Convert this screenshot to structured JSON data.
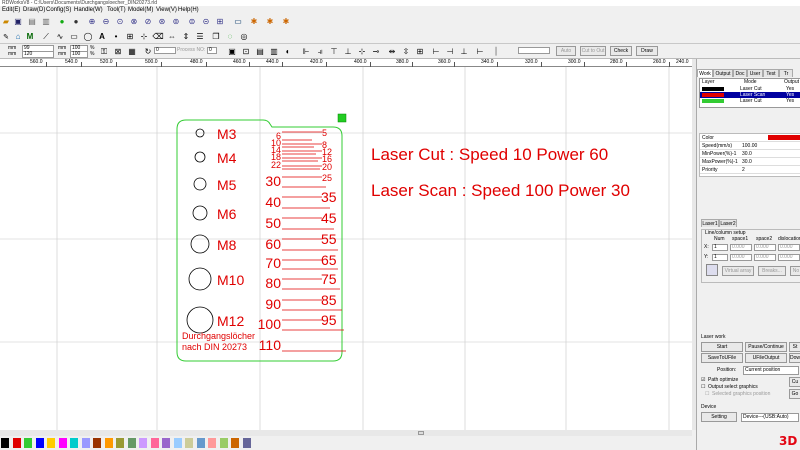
{
  "window": {
    "title": "RDWorksV8 - C:\\Users\\Documents\\Durchgangsloecher_DIN20273.rld"
  },
  "menu": [
    {
      "label": "Edit(E)"
    },
    {
      "label": "Draw(D)"
    },
    {
      "label": "Config(S)"
    },
    {
      "label": "Handle(W)"
    },
    {
      "label": "Tool(T)"
    },
    {
      "label": "Model(M)"
    },
    {
      "label": "View(V)"
    },
    {
      "label": "Help(H)"
    }
  ],
  "toolbar2": {
    "unit1": "mm",
    "unit2": "mm",
    "width_value": "99",
    "height_value": "120",
    "scale_w": "100",
    "scale_h": "100",
    "pct1": "%",
    "pct2": "%",
    "rotate_value": "0",
    "process_no_label": "Process NO:",
    "process_no_value": "0"
  },
  "toolbar3": {
    "auto_label": "Auto",
    "cut_to_out_label": "Cut to Out",
    "check_label": "Check",
    "draw_label": "Draw"
  },
  "ruler": {
    "labels": [
      "560.0",
      "540.0",
      "520.0",
      "500.0",
      "480.0",
      "460.0",
      "440.0",
      "420.0",
      "400.0",
      "380.0",
      "360.0",
      "340.0",
      "320.0",
      "300.0",
      "280.0",
      "260.0",
      "240.0"
    ]
  },
  "artwork": {
    "holes": [
      {
        "label": "M3"
      },
      {
        "label": "M4"
      },
      {
        "label": "M5"
      },
      {
        "label": "M6"
      },
      {
        "label": "M8"
      },
      {
        "label": "M10"
      },
      {
        "label": "M12"
      }
    ],
    "note_line1": "Durchgangslöcher",
    "note_line2": "nach DIN 20273",
    "scale_left": [
      "6",
      "10",
      "14",
      "18",
      "22",
      "30",
      "40",
      "50",
      "60",
      "70",
      "80",
      "90",
      "100",
      "110"
    ],
    "scale_right": [
      "5",
      "8",
      "12",
      "16",
      "20",
      "25",
      "35",
      "45",
      "55",
      "65",
      "75",
      "85",
      "95"
    ],
    "heading_cut": "Laser Cut : Speed 10 Power 60",
    "heading_scan": "Laser  Scan : Speed 100 Power 30"
  },
  "right_panel": {
    "tabs": [
      "Work",
      "Output",
      "Doc",
      "User",
      "Test",
      "Tr"
    ],
    "layer_headers": [
      "Layer",
      "Mode",
      "Output"
    ],
    "layers": [
      {
        "color": "#000000",
        "mode": "Laser Cut",
        "output": "Yes"
      },
      {
        "color": "#e00000",
        "mode": "Laser Scan",
        "output": "Yes"
      },
      {
        "color": "#33cc33",
        "mode": "Laser Cut",
        "output": "Yes"
      }
    ],
    "props": [
      {
        "label": "Color",
        "value": ""
      },
      {
        "label": "Speed(mm/s)",
        "value": "100.00"
      },
      {
        "label": "MinPower(%)-1",
        "value": "30.0"
      },
      {
        "label": "MaxPower(%)-1",
        "value": "30.0"
      },
      {
        "label": "Priority",
        "value": "2"
      }
    ],
    "laser_tabs": [
      "Laser1",
      "Laser2"
    ],
    "line_setup_title": "Line/column setup",
    "line_setup_headers": [
      "Num",
      "space1",
      "space2",
      "dislocation"
    ],
    "row_x_label": "X:",
    "row_y_label": "Y:",
    "row_num": "1",
    "row_zero": "0.000",
    "virtual_array_label": "Virtual array",
    "breaks_label": "Breaks...",
    "no_label": "No",
    "laser_work_title": "Laser work",
    "start_label": "Start",
    "pause_label": "Pause/Continue",
    "stop_label": "St",
    "save_label": "SaveToUFile",
    "ufile_label": "UFileOutput",
    "dow_label": "Dow",
    "position_label": "Position:",
    "position_value": "Current position",
    "path_optimize_label": "Path optimize",
    "output_select_label": "Output select graphics",
    "selected_position_label": "Selected graphics position",
    "cu_label": "Cu",
    "go_label": "Go",
    "device_title": "Device",
    "setting_label": "Setting",
    "device_value": "Device---(USB:Auto)"
  },
  "palette": [
    "#000000",
    "#e00000",
    "#33cc33",
    "#0000ff",
    "#ffcc00",
    "#ff00ff",
    "#00cccc",
    "#9999ff",
    "#993300",
    "#ff9900",
    "#999933",
    "#669966",
    "#cc99ff",
    "#ff6699",
    "#9966cc",
    "#99ccff",
    "#cccc99",
    "#6699cc",
    "#ff9999",
    "#99cc66",
    "#cc6600",
    "#666699"
  ],
  "branding": {
    "logo": "3D"
  },
  "colors": {
    "accent_red": "#e00000",
    "green_outline": "#33cc33"
  }
}
